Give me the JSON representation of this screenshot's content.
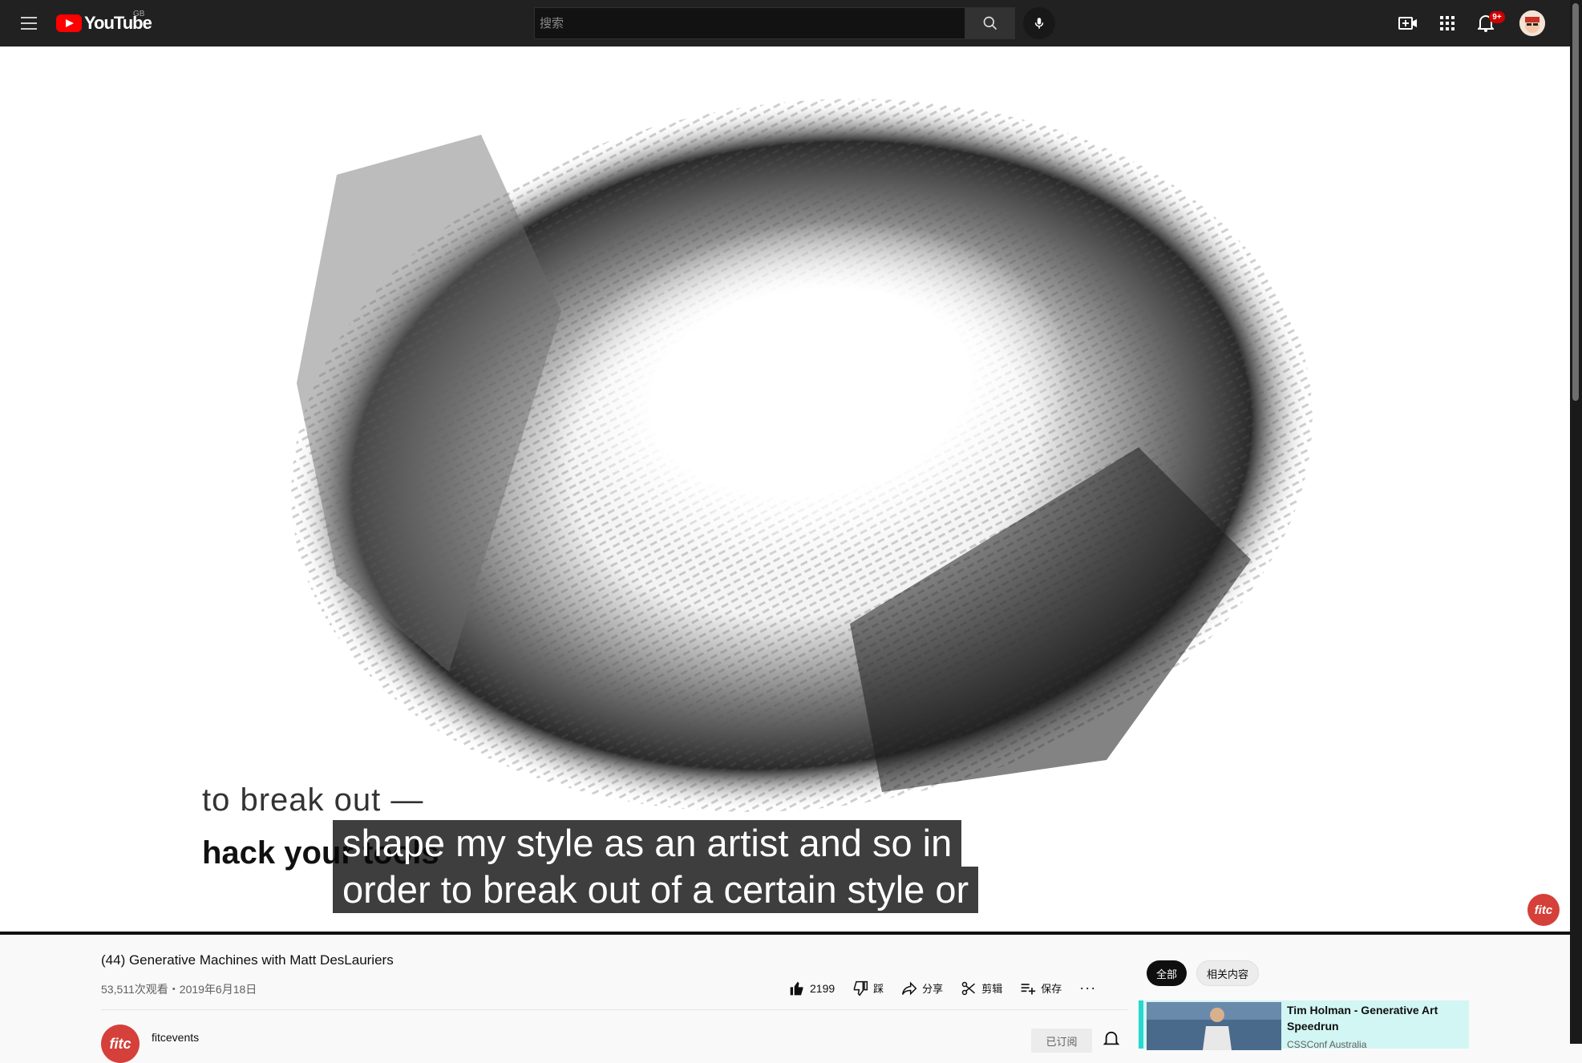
{
  "header": {
    "logo_text": "YouTube",
    "region": "GB",
    "search_placeholder": "搜索",
    "notification_count": "9+"
  },
  "video": {
    "slide_line1": "to break out —",
    "slide_line2": "hack your tools",
    "caption_line1": "shape my style as an artist and so in",
    "caption_line2": "order to break out of a certain style or",
    "watermark": "fitc"
  },
  "details": {
    "title": "(44) Generative Machines with Matt DesLauriers",
    "meta": "53,511次观看・2019年6月18日",
    "likes": "2199",
    "dislike_label": "踩",
    "share_label": "分享",
    "clip_label": "剪辑",
    "save_label": "保存",
    "more_label": "···",
    "channel_name": "fitcevents",
    "channel_avatar_text": "fitc",
    "subscribe_label": "已订阅"
  },
  "sidebar": {
    "chips": [
      {
        "label": "全部"
      },
      {
        "label": "相关内容"
      }
    ],
    "recommendations": [
      {
        "title": "Tim Holman - Generative Art Speedrun",
        "channel": "CSSConf Australia"
      }
    ]
  },
  "colors": {
    "topbar": "#212121",
    "accent": "#ff0000",
    "highlight_card": "#d2f6f3",
    "highlight_border": "#26d9cf"
  }
}
